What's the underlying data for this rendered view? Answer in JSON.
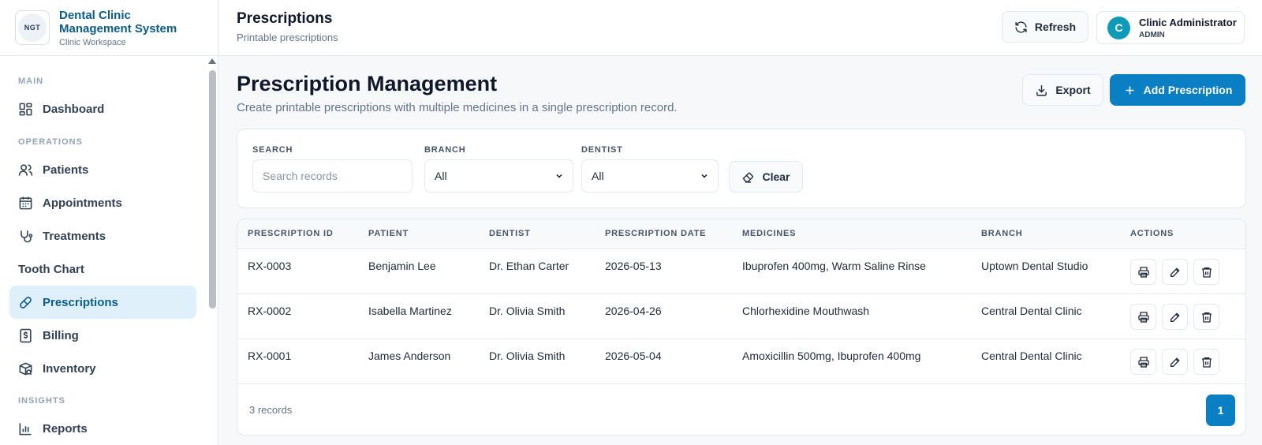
{
  "brand": {
    "logo_text": "NGT",
    "title": "Dental Clinic Management System",
    "subtitle": "Clinic Workspace"
  },
  "sidebar": {
    "sections": {
      "main": "MAIN",
      "operations": "OPERATIONS",
      "insights": "INSIGHTS"
    },
    "items": [
      {
        "label": "Dashboard",
        "icon": "dashboard-icon"
      },
      {
        "label": "Patients",
        "icon": "users-icon"
      },
      {
        "label": "Appointments",
        "icon": "calendar-icon"
      },
      {
        "label": "Treatments",
        "icon": "stethoscope-icon"
      },
      {
        "label": "Tooth Chart",
        "icon": ""
      },
      {
        "label": "Prescriptions",
        "icon": "pill-icon",
        "active": true
      },
      {
        "label": "Billing",
        "icon": "dollar-icon"
      },
      {
        "label": "Inventory",
        "icon": "package-icon"
      },
      {
        "label": "Reports",
        "icon": "bar-chart-icon"
      }
    ]
  },
  "header": {
    "title": "Prescriptions",
    "subtitle": "Printable prescriptions",
    "refresh_label": "Refresh",
    "user": {
      "initial": "C",
      "name": "Clinic Administrator",
      "role": "ADMIN"
    }
  },
  "main": {
    "title": "Prescription Management",
    "subtitle": "Create printable prescriptions with multiple medicines in a single prescription record.",
    "export_label": "Export",
    "add_label": "Add Prescription"
  },
  "filters": {
    "search_label": "SEARCH",
    "search_placeholder": "Search records",
    "branch_label": "BRANCH",
    "branch_value": "All",
    "dentist_label": "DENTIST",
    "dentist_value": "All",
    "clear_label": "Clear"
  },
  "table": {
    "columns": [
      "PRESCRIPTION ID",
      "PATIENT",
      "DENTIST",
      "PRESCRIPTION DATE",
      "MEDICINES",
      "BRANCH",
      "ACTIONS"
    ],
    "rows": [
      [
        "RX-0003",
        "Benjamin Lee",
        "Dr. Ethan Carter",
        "2026-05-13",
        "Ibuprofen 400mg, Warm Saline Rinse",
        "Uptown Dental Studio"
      ],
      [
        "RX-0002",
        "Isabella Martinez",
        "Dr. Olivia Smith",
        "2026-04-26",
        "Chlorhexidine Mouthwash",
        "Central Dental Clinic"
      ],
      [
        "RX-0001",
        "James Anderson",
        "Dr. Olivia Smith",
        "2026-05-04",
        "Amoxicillin 500mg, Ibuprofen 400mg",
        "Central Dental Clinic"
      ]
    ],
    "record_count": "3 records",
    "page": "1"
  },
  "colors": {
    "accent": "#0a7fc3",
    "brand": "#0b5c8a",
    "active_nav_bg": "#e0f0fb",
    "avatar": "#0f9bb7"
  }
}
